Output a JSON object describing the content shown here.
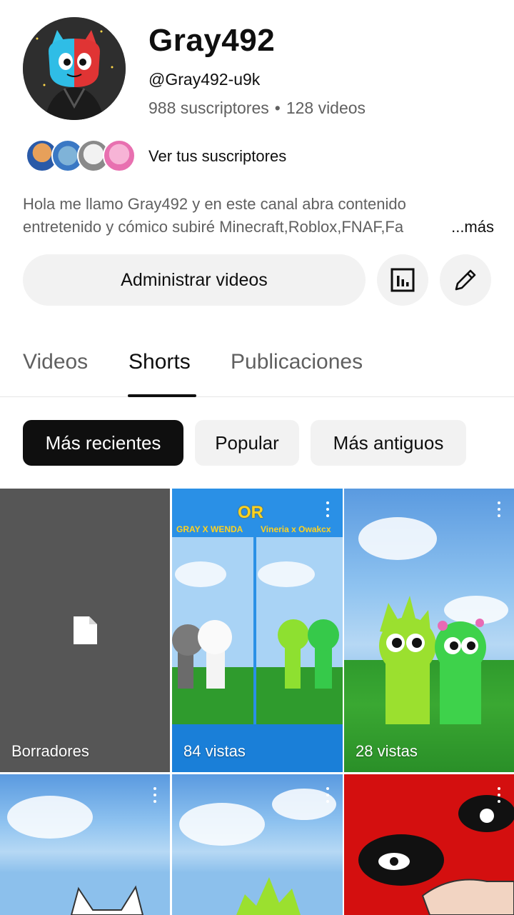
{
  "channel": {
    "name": "Gray492",
    "handle": "@Gray492-u9k",
    "subscribers": "988 suscriptores",
    "separator": "•",
    "videos": "128 videos",
    "see_subscribers": "Ver tus suscriptores",
    "description_line1": "Hola me llamo Gray492 y en este canal abra contenido",
    "description_line2": "entretenido y cómico subiré Minecraft,Roblox,FNAF,Fa",
    "more": "...más"
  },
  "actions": {
    "manage_videos": "Administrar videos",
    "analytics_icon": "analytics-icon",
    "edit_icon": "pencil-icon"
  },
  "tabs": [
    {
      "label": "Videos",
      "active": false
    },
    {
      "label": "Shorts",
      "active": true
    },
    {
      "label": "Publicaciones",
      "active": false
    }
  ],
  "chips": [
    {
      "label": "Más recientes",
      "selected": true
    },
    {
      "label": "Popular",
      "selected": false
    },
    {
      "label": "Más antiguos",
      "selected": false
    }
  ],
  "grid": [
    {
      "label": "Borradores",
      "kind": "drafts",
      "icon": "document-icon"
    },
    {
      "label": "84 vistas",
      "kind": "short",
      "header_title": "OR",
      "caption_left": "GRAY X WENDA",
      "caption_right": "Vineria x Owakcx"
    },
    {
      "label": "28 vistas",
      "kind": "short"
    },
    {
      "label": "",
      "kind": "short"
    },
    {
      "label": "",
      "kind": "short"
    },
    {
      "label": "",
      "kind": "short"
    }
  ],
  "colors": {
    "accent_dark": "#0f0f0f",
    "secondary_text": "#606060",
    "chip_bg": "#f2f2f2",
    "drafts_bg": "#565656",
    "red_tile": "#d40f0f"
  }
}
